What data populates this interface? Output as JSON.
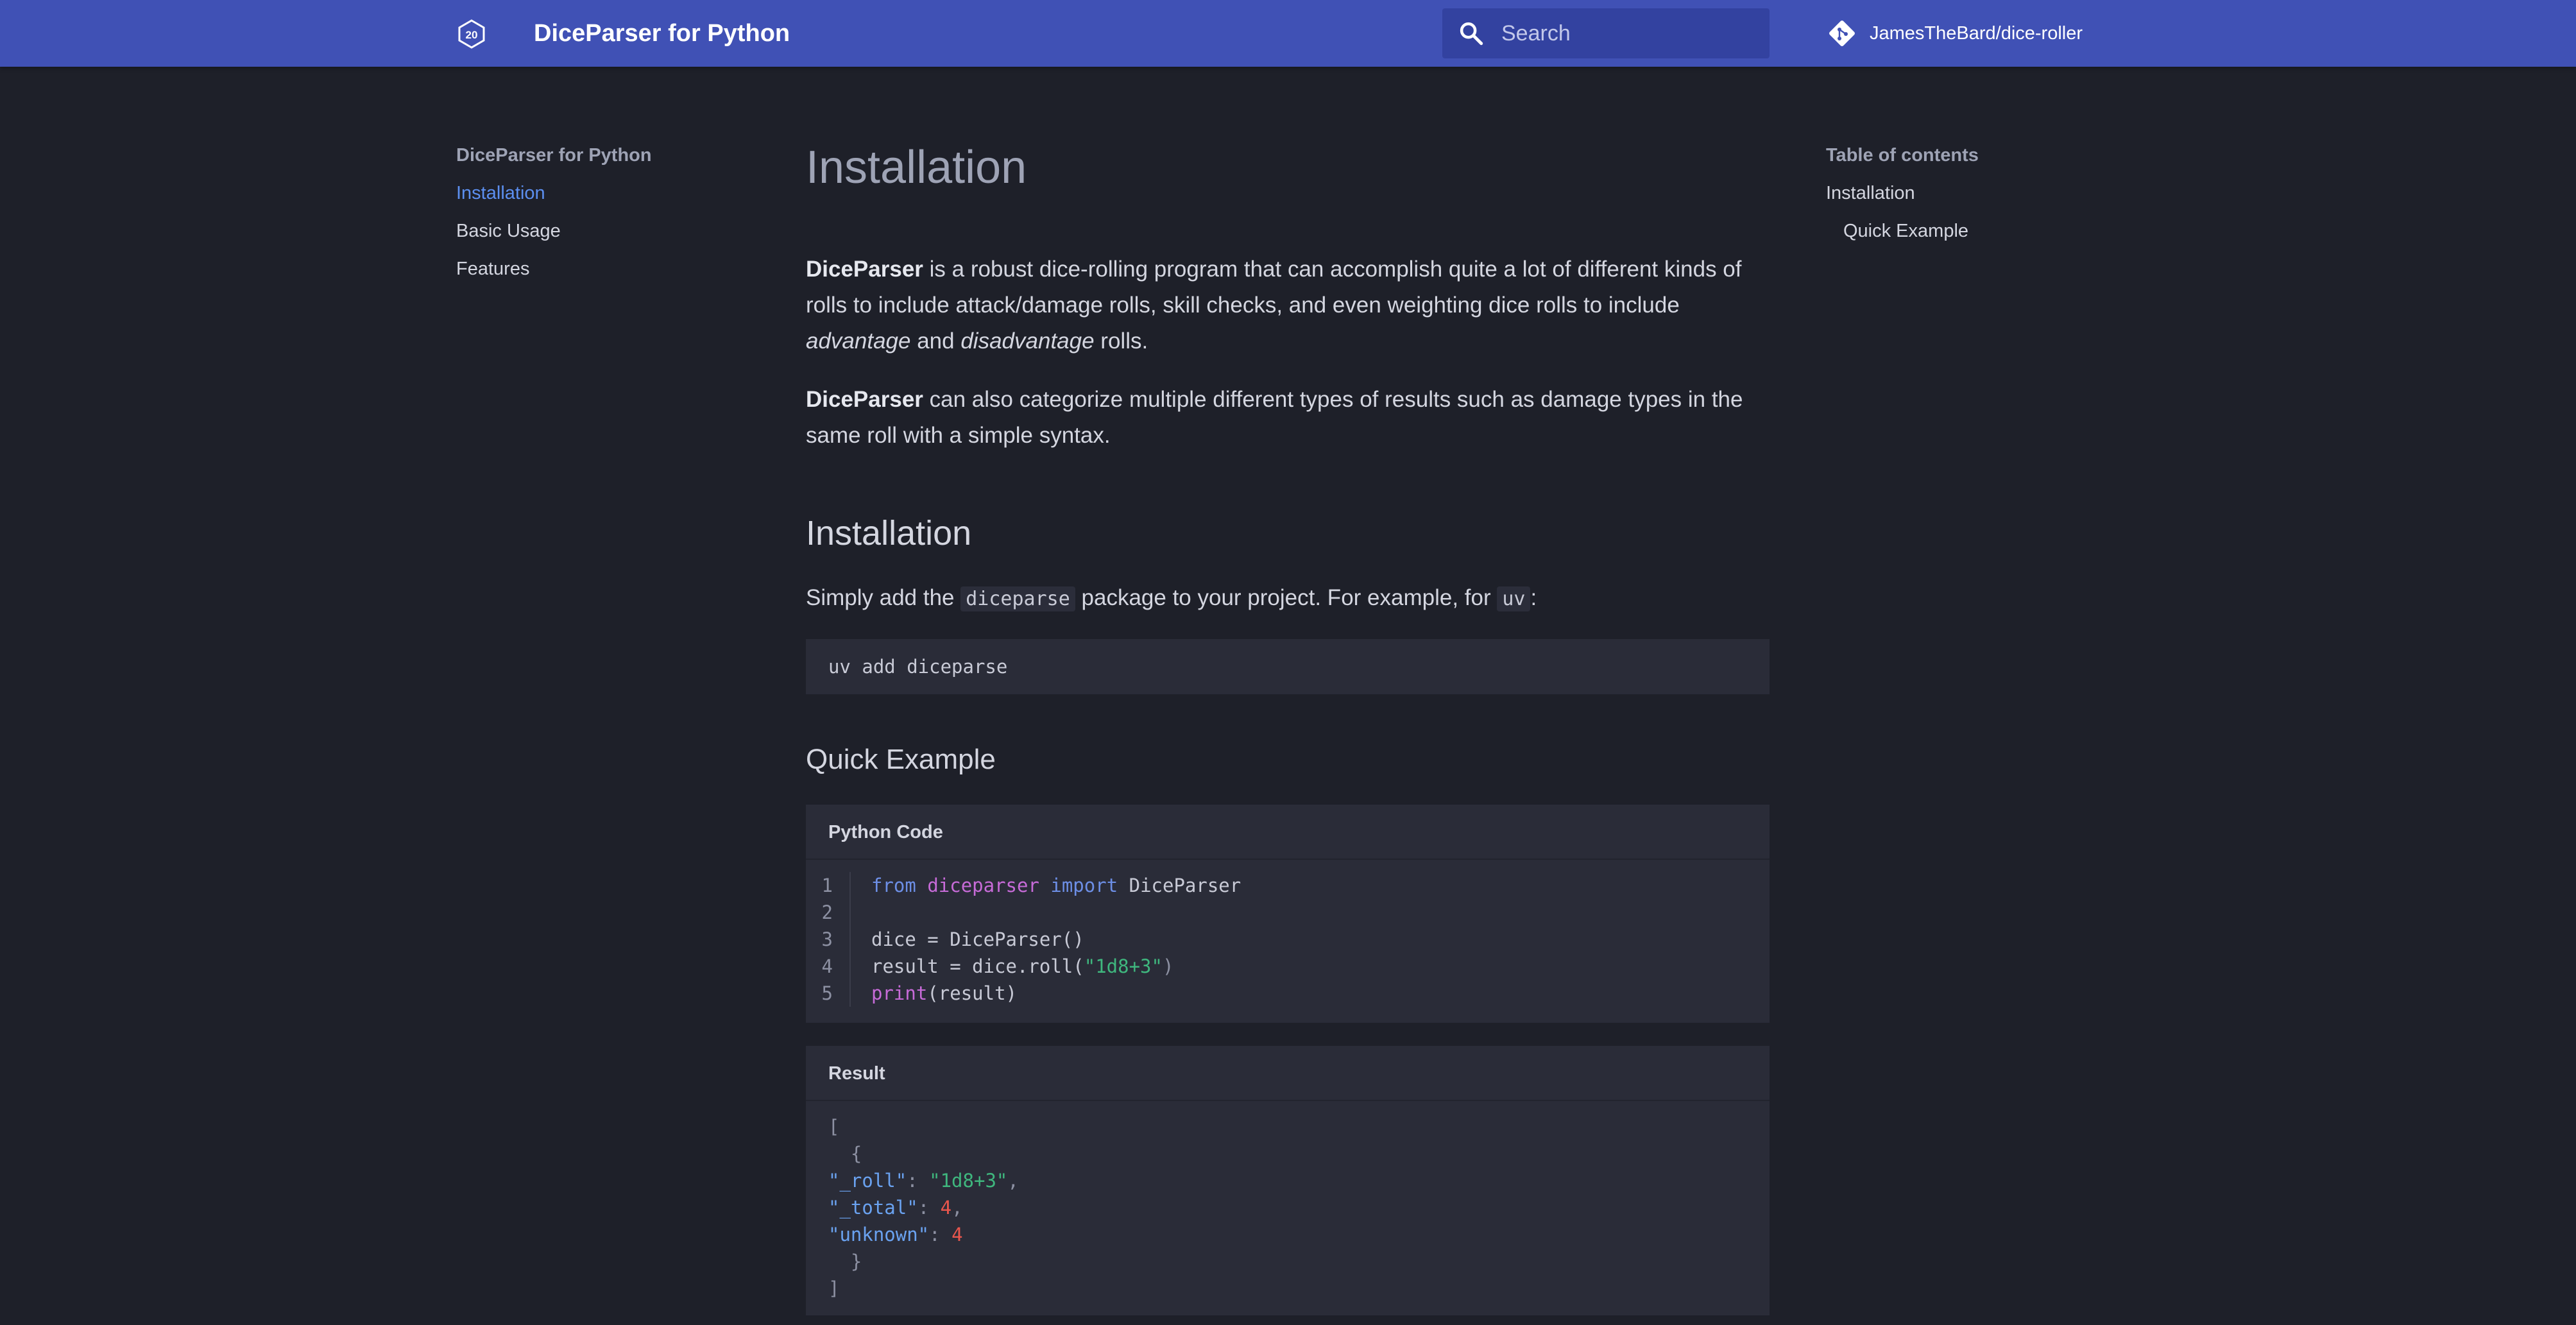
{
  "header": {
    "site_title": "DiceParser for Python",
    "search_placeholder": "Search",
    "repo_name": "JamesTheBard/dice-roller",
    "logo_text": "20",
    "colors": {
      "bar": "#4051b5",
      "search": "#3342a0"
    }
  },
  "left_nav": {
    "title": "DiceParser for Python",
    "items": [
      {
        "label": "Installation",
        "active": true
      },
      {
        "label": "Basic Usage",
        "active": false
      },
      {
        "label": "Features",
        "active": false
      }
    ]
  },
  "toc": {
    "title": "Table of contents",
    "items": [
      {
        "label": "Installation",
        "level": 1
      },
      {
        "label": "Quick Example",
        "level": 2
      }
    ]
  },
  "main": {
    "title": "Installation",
    "intro1": {
      "bold": "DiceParser",
      "text1": " is a robust dice-rolling program that can accomplish quite a lot of different kinds of rolls to include attack/damage rolls, skill checks, and even weighting dice rolls to include ",
      "em1": "advantage",
      "text2": " and ",
      "em2": "disadvantage",
      "text3": " rolls."
    },
    "intro2": {
      "bold": "DiceParser",
      "text": " can also categorize multiple different types of results such as damage types in the same roll with a simple syntax."
    },
    "install_heading": "Installation",
    "install_text": {
      "pre": "Simply add the ",
      "code1": "diceparse",
      "mid": " package to your project. For example, for ",
      "code2": "uv",
      "post": ":"
    },
    "install_command": "uv add diceparse",
    "quick_heading": "Quick Example",
    "python_block": {
      "title": "Python Code",
      "line_numbers": [
        "1",
        "2",
        "3",
        "4",
        "5"
      ],
      "l1": {
        "from": "from",
        "module": "diceparser",
        "import": "import",
        "name": " DiceParser"
      },
      "l3": "dice = DiceParser()",
      "l4": {
        "pre": "result = dice.roll(",
        "str": "\"1d8+3\"",
        "post": ")"
      },
      "l5": {
        "fn": "print",
        "args": "(result)"
      }
    },
    "result_block": {
      "title": "Result",
      "open_bracket": "[",
      "open_brace": "  {",
      "k1": "\"_roll\"",
      "v1": "\"1d8+3\"",
      "k2": "\"_total\"",
      "v2": "4",
      "k3": "\"unknown\"",
      "v3": "4",
      "close_brace": "  }",
      "close_bracket": "]"
    }
  },
  "colors": {
    "background": "#1e2029",
    "accent_link": "#5c8ff0",
    "code_background": "#2a2c38",
    "keyword": "#6d8fe6",
    "string": "#3fb77e",
    "number": "#e8564d"
  }
}
